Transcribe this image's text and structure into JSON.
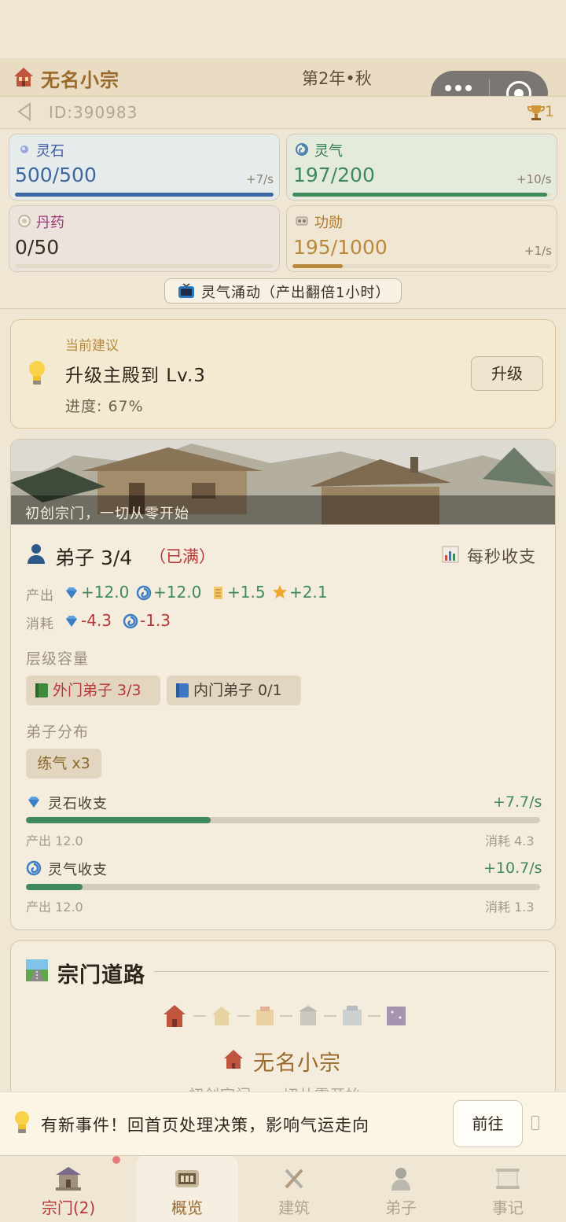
{
  "header": {
    "sect_name": "无名小宗",
    "season": "第2年•秋",
    "id_text": "ID:390983",
    "trophy_count": "1"
  },
  "resources": [
    {
      "name": "灵石",
      "value": "500/500",
      "rate": "+7/s",
      "fill": 1.0,
      "color": "#3d67a0",
      "name_color": "#3d5d9a"
    },
    {
      "name": "灵气",
      "value": "197/200",
      "rate": "+10/s",
      "fill": 0.985,
      "color": "#3f8a5c",
      "name_color": "#2f7a4c"
    },
    {
      "name": "丹药",
      "value": "0/50",
      "rate": "",
      "fill": 0.0,
      "color": "#9b3a7a",
      "name_color": "#9b3a7a"
    },
    {
      "name": "功勋",
      "value": "195/1000",
      "rate": "+1/s",
      "fill": 0.195,
      "color": "#b8893d",
      "name_color": "#b07a2c"
    }
  ],
  "boost": {
    "label": "灵气涌动（产出翻倍1小时）"
  },
  "suggestion": {
    "label": "当前建议",
    "title": "升级主殿到 Lv.3",
    "progress": "进度: 67%",
    "button": "升级"
  },
  "banner": {
    "caption": "初创宗门，一切从零开始"
  },
  "disciples": {
    "title": "弟子 3/4",
    "full": "（已满）",
    "flow_link": "每秒收支",
    "output_label": "产出",
    "outputs": [
      "+12.0",
      "+12.0",
      "+1.5",
      "+2.1"
    ],
    "consume_label": "消耗",
    "consumes": [
      "-4.3",
      "-1.3"
    ],
    "capacity_label": "层级容量",
    "tiers": [
      "外门弟子 3/3",
      "内门弟子 0/1"
    ],
    "distribution_label": "弟子分布",
    "distribution": [
      "练气 x3"
    ]
  },
  "flows": [
    {
      "label": "灵石收支",
      "rate": "+7.7/s",
      "fill": 0.36,
      "produce": "产出 12.0",
      "consume": "消耗 4.3"
    },
    {
      "label": "灵气收支",
      "rate": "+10.7/s",
      "fill": 0.11,
      "produce": "产出 12.0",
      "consume": "消耗 1.3"
    }
  ],
  "road": {
    "title": "宗门道路",
    "stage_name": "无名小宗",
    "stage_desc": "初创宗门，一切从零开始"
  },
  "notice": {
    "text": "有新事件！回首页处理决策，影响气运走向",
    "button": "前往"
  },
  "tabs": [
    {
      "label": "宗门(2)",
      "color": "#b8373a"
    },
    {
      "label": "概览",
      "color": "#9a6a2c"
    },
    {
      "label": "建筑",
      "color": "#b2a690"
    },
    {
      "label": "弟子",
      "color": "#b2a690"
    },
    {
      "label": "事记",
      "color": "#b2a690"
    }
  ],
  "icons": [
    "house-icon",
    "back-arrow-icon",
    "trophy-icon",
    "spirit-stone-icon",
    "spirit-qi-icon",
    "pill-icon",
    "merit-icon",
    "tv-icon",
    "bulb-icon",
    "person-icon",
    "chart-icon",
    "diamond-icon",
    "swirl-icon",
    "scroll-icon",
    "star-icon",
    "book-green-icon",
    "book-blue-icon",
    "road-icon"
  ]
}
